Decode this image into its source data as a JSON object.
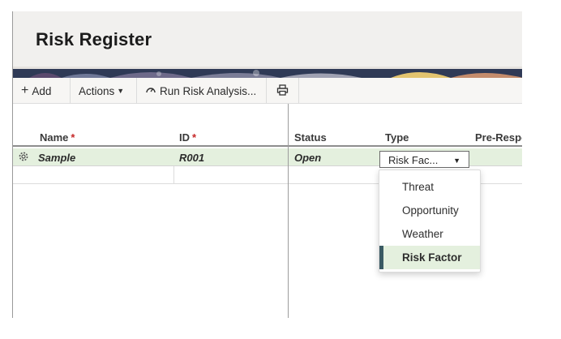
{
  "page": {
    "title": "Risk Register"
  },
  "toolbar": {
    "add_label": "Add",
    "actions_label": "Actions",
    "run_label": "Run Risk Analysis..."
  },
  "grid": {
    "columns": {
      "name": "Name",
      "id": "ID",
      "status": "Status",
      "type": "Type",
      "pre_response": "Pre-Respo"
    },
    "required_mark": "*",
    "row": {
      "name": "Sample",
      "id": "R001",
      "status": "Open",
      "type_value": "Risk Fac..."
    }
  },
  "type_dropdown": {
    "options": [
      "Threat",
      "Opportunity",
      "Weather",
      "Risk Factor"
    ],
    "selected": "Risk Factor"
  },
  "icons": [
    "plus-icon",
    "caret-down-icon",
    "gauge-icon",
    "print-icon",
    "gear-icon"
  ],
  "colors": {
    "selected_row": "#e4f0de",
    "required": "#c62828",
    "header_bg": "#f1f0ee",
    "selected_accent": "#3a5a63"
  }
}
